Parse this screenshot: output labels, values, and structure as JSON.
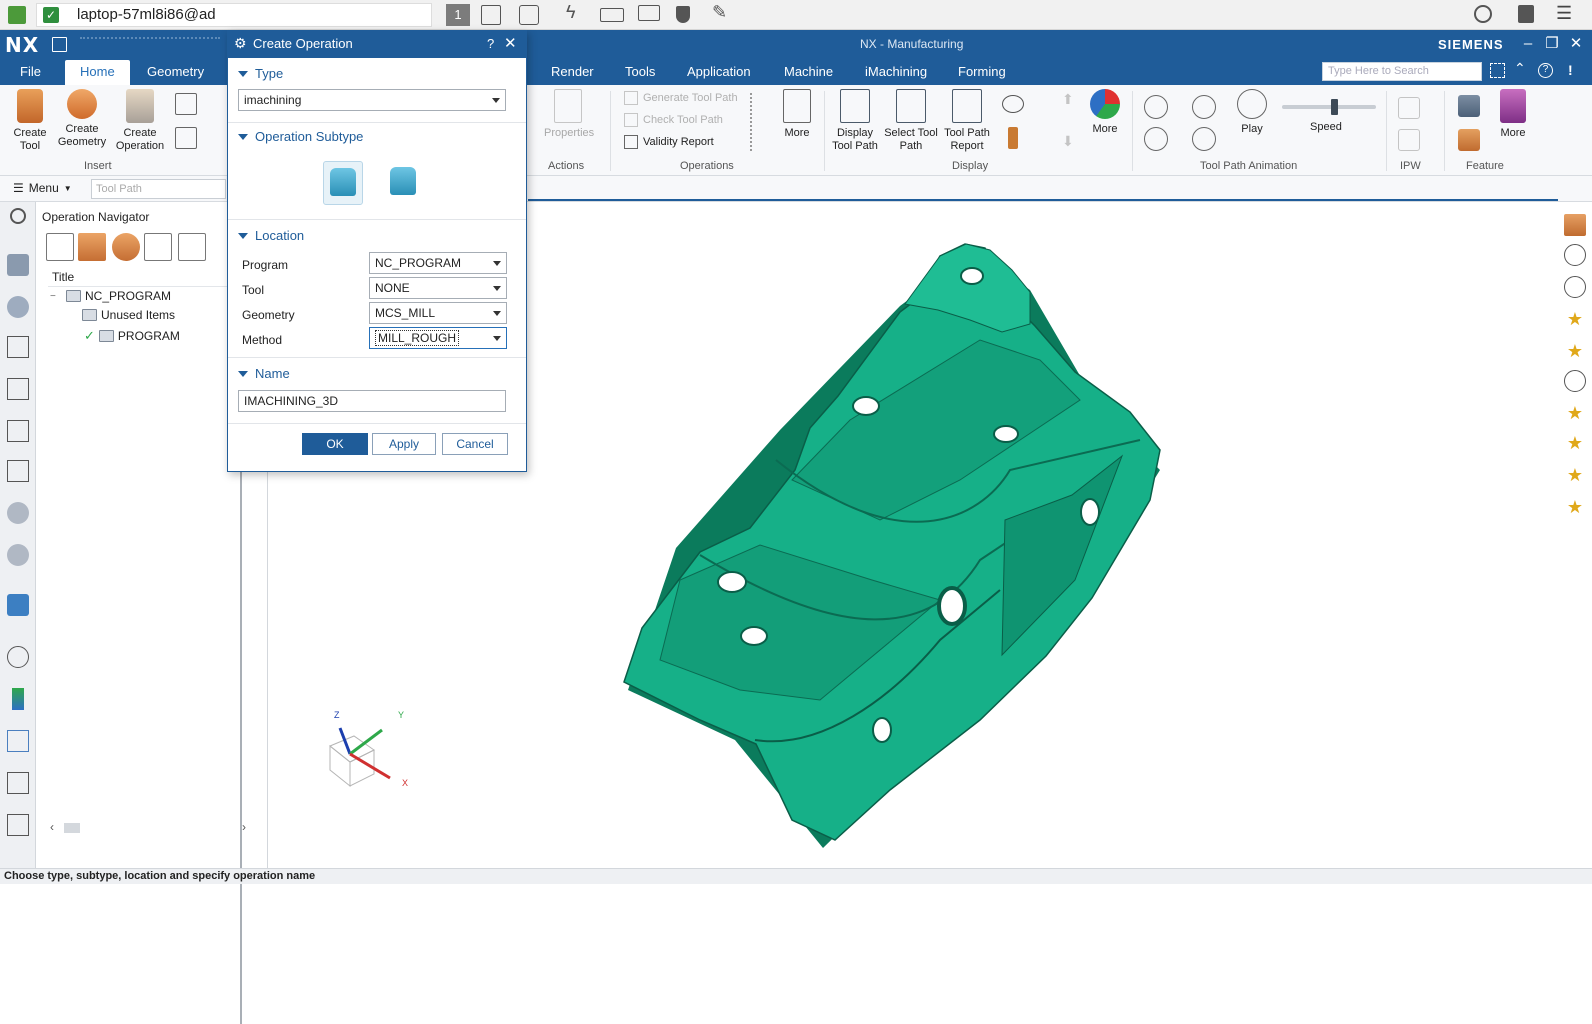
{
  "remote_bar": {
    "host": "laptop-57ml8i86@ad",
    "session_number": "1"
  },
  "window": {
    "app_logo": "NX",
    "title": "NX - Manufacturing",
    "brand": "SIEMENS"
  },
  "menu_tabs": [
    "File",
    "Home",
    "Geometry",
    "Render",
    "Tools",
    "Application",
    "Machine",
    "iMachining",
    "Forming"
  ],
  "active_tab": "Home",
  "search": {
    "placeholder": "Type Here to Search"
  },
  "ribbon": {
    "insert": {
      "create_tool": "Create Tool",
      "create_geometry": "Create Geometry",
      "create_operation": "Create Operation",
      "group": "Insert"
    },
    "actions": {
      "properties": "Properties",
      "group": "Actions"
    },
    "operations": {
      "generate": "Generate Tool Path",
      "check": "Check Tool Path",
      "validity": "Validity Report",
      "more": "More",
      "group": "Operations"
    },
    "display": {
      "display_tool_path": "Display Tool Path",
      "select_tool_path": "Select Tool Path",
      "tool_path_report": "Tool Path Report",
      "more": "More",
      "group": "Display"
    },
    "animation": {
      "play": "Play",
      "speed": "Speed",
      "speed_value": 0.55,
      "group": "Tool Path Animation"
    },
    "ipw": {
      "group": "IPW"
    },
    "feature": {
      "more": "More",
      "group": "Feature"
    }
  },
  "toolrow": {
    "menu": "Menu",
    "filter": "Tool Path"
  },
  "navigator": {
    "title": "Operation Navigator",
    "column": "Title",
    "items": [
      {
        "label": "NC_PROGRAM"
      },
      {
        "label": "Unused Items"
      },
      {
        "label": "PROGRAM"
      }
    ]
  },
  "dialog": {
    "title": "Create Operation",
    "help": "?",
    "type_section": "Type",
    "type_value": "imachining",
    "subtype_section": "Operation Subtype",
    "location_section": "Location",
    "program_label": "Program",
    "program_value": "NC_PROGRAM",
    "tool_label": "Tool",
    "tool_value": "NONE",
    "geometry_label": "Geometry",
    "geometry_value": "MCS_MILL",
    "method_label": "Method",
    "method_value": "MILL_ROUGH",
    "name_section": "Name",
    "name_value": "IMACHINING_3D",
    "ok": "OK",
    "apply": "Apply",
    "cancel": "Cancel"
  },
  "triad": {
    "x": "X",
    "y": "Y",
    "z": "Z"
  },
  "status": "Choose type, subtype, location and specify operation name",
  "colors": {
    "nx_blue": "#1f5c99",
    "part_green": "#12a57f",
    "accent": "#2670b8"
  }
}
